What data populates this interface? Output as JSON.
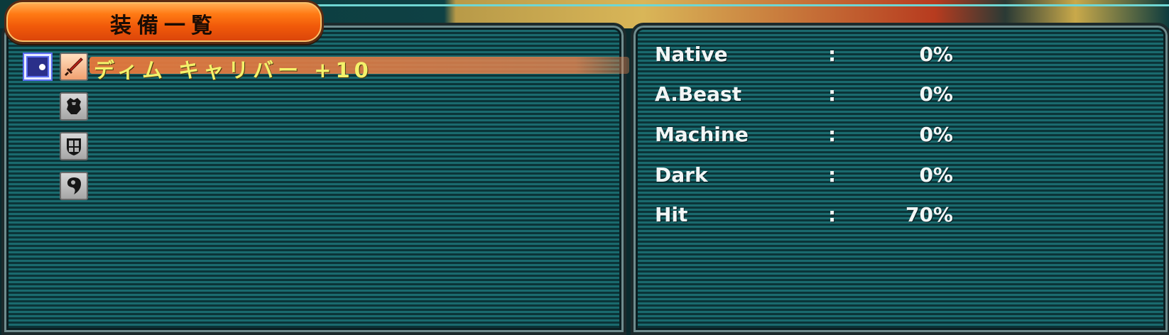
{
  "window": {
    "title": "装備一覧"
  },
  "equipment": [
    {
      "slot_icon": "sword-icon",
      "name": "ディム キャリバー +10",
      "selected": true
    },
    {
      "slot_icon": "armor-icon",
      "name": "",
      "selected": false
    },
    {
      "slot_icon": "shield-icon",
      "name": "",
      "selected": false
    },
    {
      "slot_icon": "unit-icon",
      "name": "",
      "selected": false
    }
  ],
  "stats": [
    {
      "label": "Native",
      "separator": ":",
      "value": "0%"
    },
    {
      "label": "A.Beast",
      "separator": ":",
      "value": "0%"
    },
    {
      "label": "Machine",
      "separator": ":",
      "value": "0%"
    },
    {
      "label": "Dark",
      "separator": ":",
      "value": "0%"
    },
    {
      "label": "Hit",
      "separator": ":",
      "value": "70%"
    }
  ],
  "colors": {
    "title_tab": "#f15a0a",
    "item_name": "#f4f26a",
    "selection_bar": "#e6783c",
    "panel_stripe": "#1a6a6e"
  }
}
